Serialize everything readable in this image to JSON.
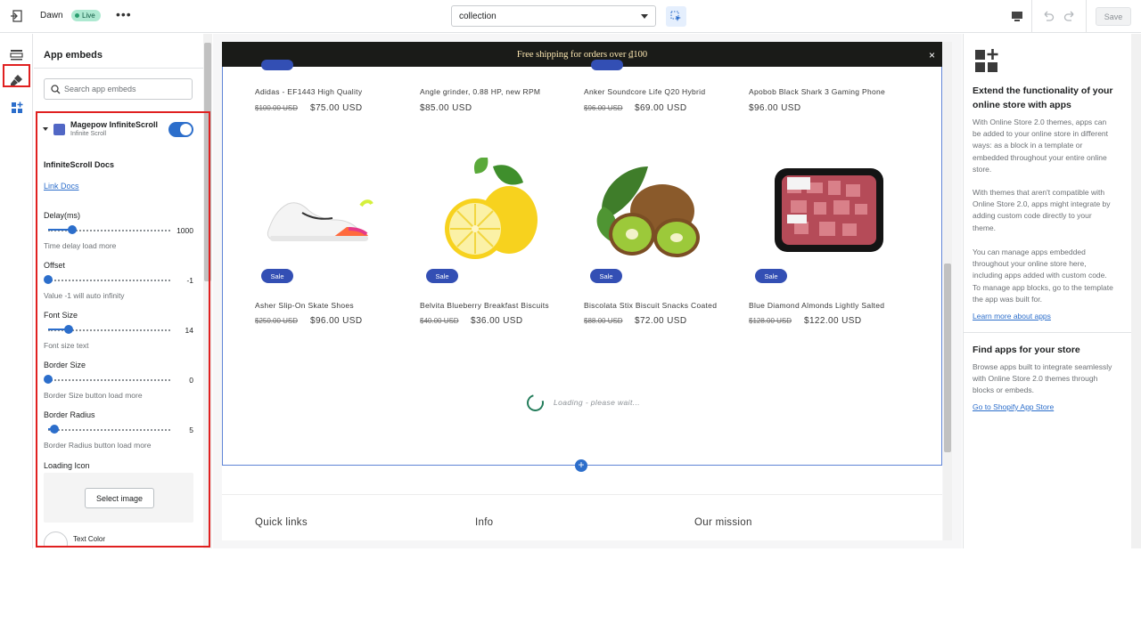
{
  "topbar": {
    "theme_name": "Dawn",
    "live_label": "Live",
    "more_label": "•••",
    "template_value": "collection",
    "save_label": "Save"
  },
  "panel": {
    "title": "App embeds",
    "search_placeholder": "Search app embeds",
    "embed": {
      "name": "Magepow InfiniteScroll",
      "subtitle": "Infinite Scroll",
      "enabled": true
    },
    "docs_title": "InfiniteScroll Docs",
    "docs_link": "Link Docs",
    "settings": [
      {
        "label": "Delay(ms)",
        "value": "1000",
        "help": "Time delay load more",
        "fraction": 0.2
      },
      {
        "label": "Offset",
        "value": "-1",
        "help": "Value -1 will auto infinity",
        "fraction": 0.0
      },
      {
        "label": "Font Size",
        "value": "14",
        "help": "Font size text",
        "fraction": 0.17
      },
      {
        "label": "Border Size",
        "value": "0",
        "help": "Border Size button load more",
        "fraction": 0.0
      },
      {
        "label": "Border Radius",
        "value": "5",
        "help": "Border Radius button load more",
        "fraction": 0.05
      }
    ],
    "loading_icon_label": "Loading Icon",
    "select_image_label": "Select image",
    "text_color_label": "Text Color"
  },
  "preview": {
    "announcement": "Free shipping for orders over ₫100",
    "close_icon": "×",
    "row1": [
      {
        "title": "Adidas - EF1443 High Quality",
        "old_price": "$100.00 USD",
        "price": "$75.00 USD"
      },
      {
        "title": "Angle grinder, 0.88 HP, new RPM",
        "old_price": "",
        "price": "$85.00 USD"
      },
      {
        "title": "Anker Soundcore Life Q20 Hybrid",
        "old_price": "$96.00 USD",
        "price": "$69.00 USD"
      },
      {
        "title": "Apobob Black Shark 3 Gaming Phone",
        "old_price": "",
        "price": "$96.00 USD"
      }
    ],
    "row2": [
      {
        "title": "Asher Slip-On Skate Shoes",
        "old_price": "$250.00 USD",
        "price": "$96.00 USD",
        "badge": "Sale"
      },
      {
        "title": "Belvita Blueberry Breakfast Biscuits",
        "old_price": "$40.00 USD",
        "price": "$36.00 USD",
        "badge": "Sale"
      },
      {
        "title": "Biscolata Stix Biscuit Snacks Coated",
        "old_price": "$88.00 USD",
        "price": "$72.00 USD",
        "badge": "Sale"
      },
      {
        "title": "Blue Diamond Almonds Lightly Salted",
        "old_price": "$128.00 USD",
        "price": "$122.00 USD",
        "badge": "Sale"
      }
    ],
    "loading_text": "Loading - please wait...",
    "footer": [
      "Quick links",
      "Info",
      "Our mission"
    ]
  },
  "right": {
    "title": "Extend the functionality of your online store with apps",
    "para1": "With Online Store 2.0 themes, apps can be added to your online store in different ways: as a block in a template or embedded throughout your entire online store.",
    "para2": "With themes that aren't compatible with Online Store 2.0, apps might integrate by adding custom code directly to your theme.",
    "para3": "You can manage apps embedded throughout your online store here, including apps added with custom code. To manage app blocks, go to the template the app was built for.",
    "learn_link": "Learn more about apps",
    "find_title": "Find apps for your store",
    "find_text": "Browse apps built to integrate seamlessly with Online Store 2.0 themes through blocks or embeds.",
    "store_link": "Go to Shopify App Store"
  },
  "colors": {
    "accent": "#2c6ecb",
    "highlight": "#e02020",
    "sale_badge": "#334fb4",
    "announcement_bg": "#1a1b18"
  }
}
